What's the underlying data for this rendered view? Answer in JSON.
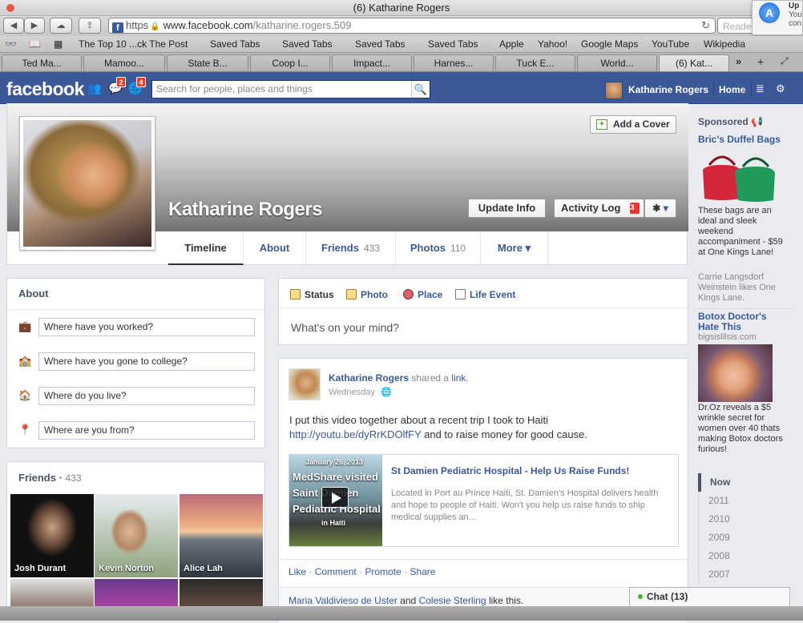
{
  "browser": {
    "window_title": "(6) Katharine Rogers",
    "url_scheme": "https",
    "url_domain": "www.facebook.com",
    "url_path": "/katharine.rogers.509",
    "reader": "Reader",
    "bookmarks": [
      "The Top 10 ...ck The Post",
      "Saved Tabs",
      "Saved Tabs",
      "Saved Tabs",
      "Saved Tabs",
      "Apple",
      "Yahoo!",
      "Google Maps",
      "YouTube",
      "Wikipedia"
    ],
    "tabs": [
      "Ted Ma...",
      "Mamoo...",
      "State B...",
      "Coop I...",
      "Impact...",
      "Harnes...",
      "Tuck E...",
      "World...",
      "(6) Kat..."
    ],
    "notification": {
      "line1": "Up",
      "line2": "You",
      "line3": "con"
    }
  },
  "fb": {
    "logo": "facebook",
    "friend_requests_badge": "",
    "messages_badge": "2",
    "notifications_badge": "4",
    "search_placeholder": "Search for people, places and things",
    "user_name": "Katharine Rogers",
    "home": "Home"
  },
  "cover": {
    "add_cover": "Add a Cover",
    "name": "Katharine Rogers",
    "update_info": "Update Info",
    "activity_log": "Activity Log",
    "activity_badge": "3",
    "tabs": [
      {
        "label": "Timeline",
        "count": ""
      },
      {
        "label": "About",
        "count": ""
      },
      {
        "label": "Friends",
        "count": "433"
      },
      {
        "label": "Photos",
        "count": "110"
      },
      {
        "label": "More",
        "count": ""
      }
    ]
  },
  "about": {
    "title": "About",
    "fields": [
      "Where have you worked?",
      "Where have you gone to college?",
      "Where do you live?",
      "Where are you from?"
    ]
  },
  "friends": {
    "title": "Friends",
    "count": "433",
    "items": [
      "Josh Durant",
      "Kevin Norton",
      "Alice Lah"
    ]
  },
  "composer": {
    "actions": [
      "Status",
      "Photo",
      "Place",
      "Life Event"
    ],
    "placeholder": "What's on your mind?"
  },
  "post": {
    "author": "Katharine Rogers",
    "shared": "shared a",
    "link_word": "link",
    "time": "Wednesday",
    "text1": "I put this video together about a recent trip I took to Haiti",
    "link": "http://youtu.be/dyRrKDOlfFY",
    "text2": "and to raise money for good cause.",
    "share_thumb_date": "January 26, 2013",
    "share_thumb_t1": "MedShare visited",
    "share_thumb_t2": "Saint Damien",
    "share_thumb_t3": "Pediatric Hospital",
    "share_thumb_t4": "in Haiti",
    "share_title": "St Damien Pediatric Hospital - Help Us Raise Funds!",
    "share_desc": "Located in Port au Prince Haiti, St. Damien's Hospital delivers health and hope to people of Haiti. Won't you help us raise funds to ship medical supplies an...",
    "actions": [
      "Like",
      "Comment",
      "Promote",
      "Share"
    ],
    "liker1": "Maria Valdivieso de Uster",
    "and": "and",
    "liker2": "Colesie Sterling",
    "like_suffix": "like this."
  },
  "sidebar": {
    "sponsored": "Sponsored",
    "ad1_title": "Bric's Duffel Bags",
    "ad1_text": "These bags are an ideal and sleek weekend accompaniment - $59 at One Kings Lane!",
    "ad1_social": "Carrie Langsdorf Weinstein likes One Kings Lane.",
    "ad2_title": "Botox Doctor's Hate This",
    "ad2_domain": "bigsislilsis.com",
    "ad2_text": "Dr.Oz reveals a $5 wrinkle secret for women over 40 thats making Botox doctors furious!",
    "years": [
      "Now",
      "2011",
      "2010",
      "2009",
      "2008",
      "2007"
    ]
  },
  "chat": {
    "label": "Chat (13)"
  }
}
